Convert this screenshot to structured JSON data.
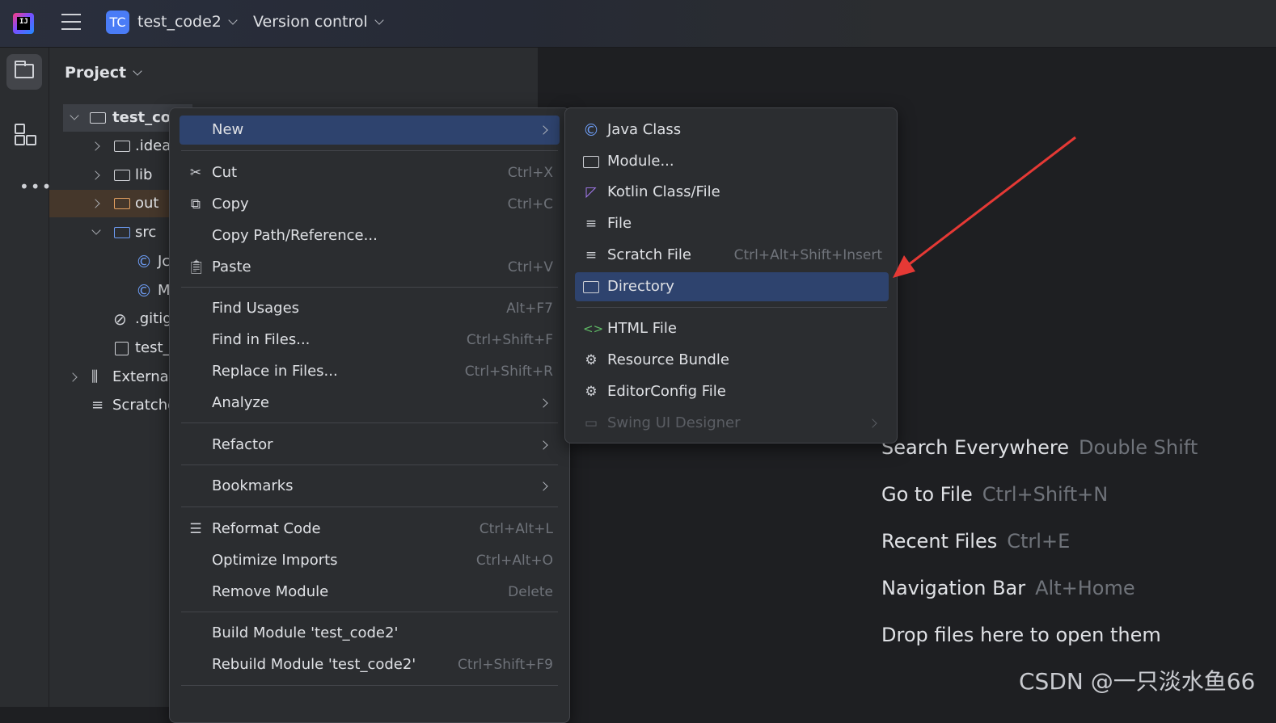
{
  "topbar": {
    "project_badge": "TC",
    "project_name": "test_code2",
    "version_control": "Version control"
  },
  "project_panel": {
    "title": "Project",
    "tree": [
      {
        "label": "test_cod",
        "kind": "module-folder"
      },
      {
        "label": ".idea",
        "kind": "folder"
      },
      {
        "label": "lib",
        "kind": "folder"
      },
      {
        "label": "out",
        "kind": "folder-excluded"
      },
      {
        "label": "src",
        "kind": "source-folder"
      },
      {
        "label": "Jc",
        "kind": "java-class"
      },
      {
        "label": "M",
        "kind": "java-class"
      },
      {
        "label": ".gitig",
        "kind": "ignore-file"
      },
      {
        "label": "test_",
        "kind": "iml-file"
      },
      {
        "label": "External",
        "kind": "libraries"
      },
      {
        "label": "Scratche",
        "kind": "scratches"
      }
    ]
  },
  "context_menu": {
    "items": [
      {
        "label": "New",
        "shortcut": "",
        "submenu": true
      },
      {
        "label": "Cut",
        "shortcut": "Ctrl+X",
        "icon": "scissors-icon"
      },
      {
        "label": "Copy",
        "shortcut": "Ctrl+C",
        "icon": "copy-icon"
      },
      {
        "label": "Copy Path/Reference...",
        "shortcut": ""
      },
      {
        "label": "Paste",
        "shortcut": "Ctrl+V",
        "icon": "paste-icon"
      },
      {
        "label": "Find Usages",
        "shortcut": "Alt+F7"
      },
      {
        "label": "Find in Files...",
        "shortcut": "Ctrl+Shift+F"
      },
      {
        "label": "Replace in Files...",
        "shortcut": "Ctrl+Shift+R"
      },
      {
        "label": "Analyze",
        "shortcut": "",
        "submenu": true
      },
      {
        "label": "Refactor",
        "shortcut": "",
        "submenu": true
      },
      {
        "label": "Bookmarks",
        "shortcut": "",
        "submenu": true
      },
      {
        "label": "Reformat Code",
        "shortcut": "Ctrl+Alt+L",
        "icon": "reformat-icon"
      },
      {
        "label": "Optimize Imports",
        "shortcut": "Ctrl+Alt+O"
      },
      {
        "label": "Remove Module",
        "shortcut": "Delete"
      },
      {
        "label": "Build Module 'test_code2'",
        "shortcut": ""
      },
      {
        "label": "Rebuild Module 'test_code2'",
        "shortcut": "Ctrl+Shift+F9"
      }
    ]
  },
  "new_submenu": {
    "items": [
      {
        "label": "Java Class",
        "shortcut": "",
        "icon": "java-class-icon"
      },
      {
        "label": "Module...",
        "shortcut": "",
        "icon": "module-icon"
      },
      {
        "label": "Kotlin Class/File",
        "shortcut": "",
        "icon": "kotlin-icon"
      },
      {
        "label": "File",
        "shortcut": "",
        "icon": "file-icon"
      },
      {
        "label": "Scratch File",
        "shortcut": "Ctrl+Alt+Shift+Insert",
        "icon": "scratch-file-icon"
      },
      {
        "label": "Directory",
        "shortcut": "",
        "icon": "folder-icon"
      },
      {
        "label": "HTML File",
        "shortcut": "",
        "icon": "html-icon"
      },
      {
        "label": "Resource Bundle",
        "shortcut": "",
        "icon": "gear-icon"
      },
      {
        "label": "EditorConfig File",
        "shortcut": "",
        "icon": "gear-icon"
      },
      {
        "label": "Swing UI Designer",
        "shortcut": "",
        "icon": "window-icon",
        "disabled": true
      }
    ]
  },
  "editor_hints": [
    {
      "action": "Search Everywhere",
      "shortcut": "Double Shift"
    },
    {
      "action": "Go to File",
      "shortcut": "Ctrl+Shift+N"
    },
    {
      "action": "Recent Files",
      "shortcut": "Ctrl+E"
    },
    {
      "action": "Navigation Bar",
      "shortcut": "Alt+Home"
    },
    {
      "action": "Drop files here to open them",
      "shortcut": ""
    }
  ],
  "watermark": "CSDN @一只淡水鱼66",
  "colors": {
    "menu_highlight": "#2e436e",
    "annotation_arrow": "#e53935",
    "project_badge": "#4a7cf6"
  }
}
